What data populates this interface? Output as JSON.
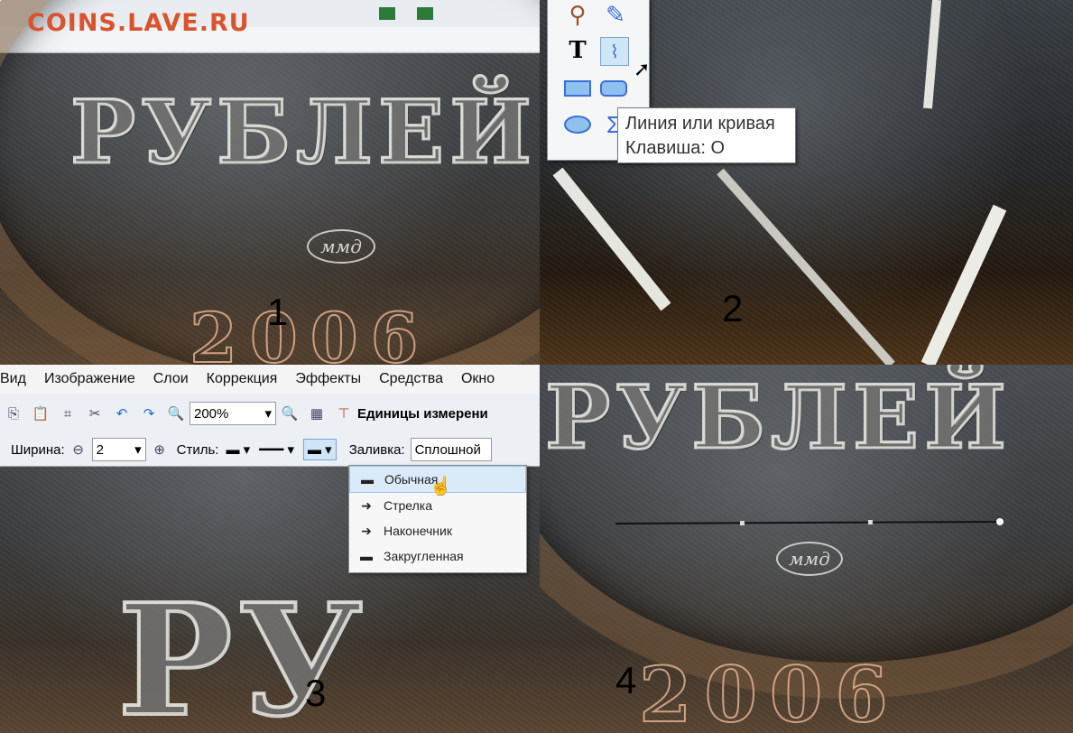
{
  "watermark": "COINS.LAVE.RU",
  "coin": {
    "legend": "РУБЛЕЙ",
    "year": "2006",
    "mint_mark": "ммд"
  },
  "panel1": {
    "number": "1"
  },
  "panel2": {
    "number": "2",
    "tooltip": {
      "title": "Линия или кривая",
      "hotkey": "Клавиша: O"
    }
  },
  "panel3": {
    "number": "3",
    "menu": [
      "Вид",
      "Изображение",
      "Слои",
      "Коррекция",
      "Эффекты",
      "Средства",
      "Окно"
    ],
    "zoom": "200%",
    "units_label": "Единицы измерени",
    "width_label": "Ширина:",
    "width_value": "2",
    "style_label": "Стиль:",
    "fill_label": "Заливка:",
    "fill_value": "Сплошной",
    "style_options": [
      "Обычная",
      "Стрелка",
      "Наконечник",
      "Закругленная"
    ]
  },
  "panel4": {
    "number": "4"
  },
  "colors": {
    "watermark": "#d9542c",
    "selection": "#dbeaf9"
  }
}
